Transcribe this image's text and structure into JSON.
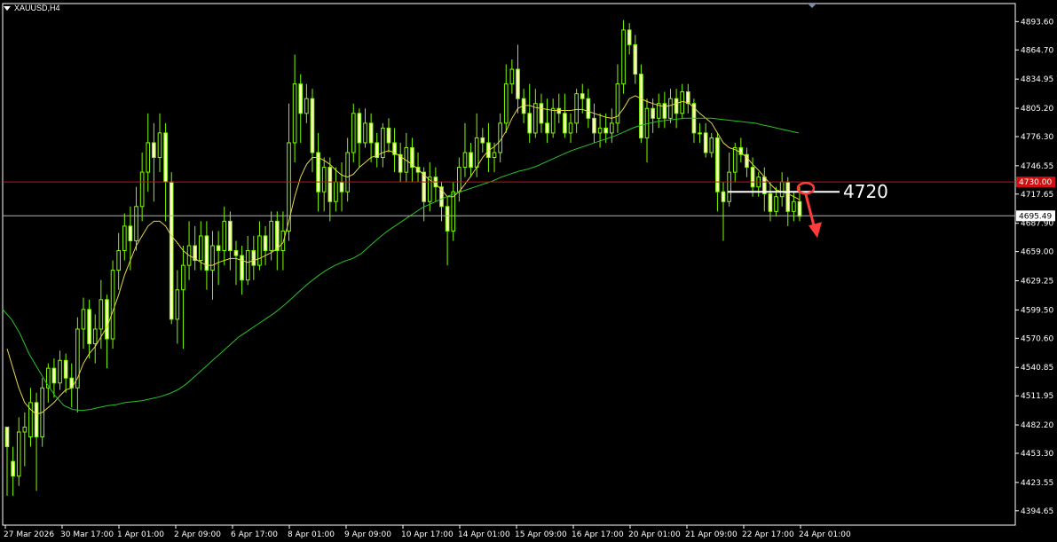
{
  "symbol_title": "XAUUSD,H4",
  "colors": {
    "background": "#000000",
    "frame": "#ffffff",
    "bull_candle": "#7cfc00",
    "bear_candle": "#ffffc0",
    "ma_fast": "#e8d44a",
    "ma_slow": "#27c427",
    "resistance_line": "#d01010",
    "current_price_line": "#b4b4b4",
    "annotation": "#ff3b3b",
    "annotation_text": "#ffffff"
  },
  "chart_data": {
    "type": "candlestick",
    "ylim": [
      4380,
      4912
    ],
    "y_ticks": [
      "4893.60",
      "4864.70",
      "4834.95",
      "4805.20",
      "4776.30",
      "4746.55",
      "4717.65",
      "4687.90",
      "4659.00",
      "4629.25",
      "4599.50",
      "4570.60",
      "4540.85",
      "4511.95",
      "4482.20",
      "4453.30",
      "4423.55",
      "4394.65"
    ],
    "x_ticks": [
      "27 Mar 2026",
      "30 Mar 17:00",
      "1 Apr 01:00",
      "2 Apr 09:00",
      "6 Apr 17:00",
      "8 Apr 01:00",
      "9 Apr 09:00",
      "10 Apr 17:00",
      "14 Apr 01:00",
      "15 Apr 09:00",
      "16 Apr 17:00",
      "20 Apr 01:00",
      "21 Apr 09:00",
      "22 Apr 17:00",
      "24 Apr 01:00"
    ],
    "resistance_price": 4730.0,
    "resistance_label": "4730.00",
    "current_price": 4695.49,
    "current_price_label": "4695.49",
    "annotation_level": 4720,
    "annotation_label": "4720",
    "candles": [
      [
        4480,
        4460,
        4410,
        4470
      ],
      [
        4445,
        4430,
        4410,
        4460
      ],
      [
        4430,
        4475,
        4420,
        4490
      ],
      [
        4475,
        4480,
        4440,
        4495
      ],
      [
        4470,
        4505,
        4460,
        4520
      ],
      [
        4505,
        4470,
        4415,
        4515
      ],
      [
        4470,
        4520,
        4460,
        4530
      ],
      [
        4520,
        4540,
        4505,
        4545
      ],
      [
        4540,
        4525,
        4510,
        4550
      ],
      [
        4525,
        4548,
        4518,
        4558
      ],
      [
        4548,
        4530,
        4515,
        4555
      ],
      [
        4530,
        4520,
        4500,
        4545
      ],
      [
        4520,
        4580,
        4495,
        4592
      ],
      [
        4580,
        4600,
        4560,
        4612
      ],
      [
        4600,
        4565,
        4550,
        4610
      ],
      [
        4565,
        4580,
        4545,
        4595
      ],
      [
        4580,
        4610,
        4560,
        4630
      ],
      [
        4610,
        4570,
        4540,
        4615
      ],
      [
        4570,
        4640,
        4560,
        4650
      ],
      [
        4640,
        4660,
        4620,
        4678
      ],
      [
        4660,
        4685,
        4650,
        4698
      ],
      [
        4685,
        4670,
        4640,
        4705
      ],
      [
        4670,
        4705,
        4660,
        4725
      ],
      [
        4705,
        4740,
        4690,
        4760
      ],
      [
        4740,
        4770,
        4720,
        4800
      ],
      [
        4770,
        4755,
        4710,
        4790
      ],
      [
        4755,
        4780,
        4740,
        4800
      ],
      [
        4780,
        4730,
        4690,
        4790
      ],
      [
        4730,
        4590,
        4585,
        4740
      ],
      [
        4590,
        4620,
        4565,
        4640
      ],
      [
        4620,
        4645,
        4560,
        4665
      ],
      [
        4645,
        4665,
        4630,
        4690
      ],
      [
        4665,
        4650,
        4640,
        4685
      ],
      [
        4650,
        4675,
        4640,
        4690
      ],
      [
        4675,
        4640,
        4620,
        4690
      ],
      [
        4640,
        4665,
        4610,
        4680
      ],
      [
        4665,
        4660,
        4625,
        4680
      ],
      [
        4660,
        4690,
        4645,
        4705
      ],
      [
        4690,
        4660,
        4640,
        4700
      ],
      [
        4660,
        4655,
        4625,
        4670
      ],
      [
        4655,
        4630,
        4615,
        4665
      ],
      [
        4630,
        4660,
        4625,
        4675
      ],
      [
        4660,
        4645,
        4630,
        4675
      ],
      [
        4645,
        4675,
        4640,
        4690
      ],
      [
        4675,
        4660,
        4645,
        4685
      ],
      [
        4660,
        4690,
        4650,
        4700
      ],
      [
        4690,
        4660,
        4640,
        4700
      ],
      [
        4660,
        4680,
        4640,
        4700
      ],
      [
        4680,
        4770,
        4670,
        4810
      ],
      [
        4770,
        4830,
        4750,
        4860
      ],
      [
        4830,
        4800,
        4770,
        4840
      ],
      [
        4800,
        4815,
        4790,
        4830
      ],
      [
        4815,
        4760,
        4740,
        4825
      ],
      [
        4760,
        4720,
        4700,
        4780
      ],
      [
        4720,
        4745,
        4700,
        4755
      ],
      [
        4745,
        4710,
        4690,
        4755
      ],
      [
        4710,
        4730,
        4700,
        4745
      ],
      [
        4730,
        4720,
        4700,
        4750
      ],
      [
        4720,
        4760,
        4710,
        4775
      ],
      [
        4760,
        4800,
        4750,
        4810
      ],
      [
        4800,
        4770,
        4745,
        4805
      ],
      [
        4770,
        4790,
        4765,
        4805
      ],
      [
        4790,
        4770,
        4750,
        4800
      ],
      [
        4770,
        4755,
        4745,
        4780
      ],
      [
        4755,
        4785,
        4745,
        4790
      ],
      [
        4785,
        4770,
        4760,
        4795
      ],
      [
        4770,
        4758,
        4740,
        4785
      ],
      [
        4758,
        4740,
        4730,
        4770
      ],
      [
        4740,
        4765,
        4730,
        4780
      ],
      [
        4765,
        4745,
        4730,
        4775
      ],
      [
        4745,
        4740,
        4730,
        4760
      ],
      [
        4740,
        4710,
        4690,
        4745
      ],
      [
        4710,
        4735,
        4700,
        4750
      ],
      [
        4735,
        4725,
        4710,
        4745
      ],
      [
        4725,
        4705,
        4690,
        4730
      ],
      [
        4705,
        4680,
        4645,
        4715
      ],
      [
        4680,
        4720,
        4670,
        4730
      ],
      [
        4720,
        4745,
        4710,
        4755
      ],
      [
        4745,
        4760,
        4735,
        4790
      ],
      [
        4760,
        4745,
        4735,
        4770
      ],
      [
        4745,
        4775,
        4735,
        4800
      ],
      [
        4775,
        4770,
        4760,
        4785
      ],
      [
        4770,
        4755,
        4740,
        4790
      ],
      [
        4755,
        4760,
        4740,
        4770
      ],
      [
        4760,
        4790,
        4750,
        4800
      ],
      [
        4790,
        4830,
        4780,
        4850
      ],
      [
        4830,
        4845,
        4820,
        4855
      ],
      [
        4845,
        4815,
        4800,
        4870
      ],
      [
        4815,
        4800,
        4790,
        4825
      ],
      [
        4800,
        4780,
        4770,
        4830
      ],
      [
        4780,
        4810,
        4775,
        4825
      ],
      [
        4810,
        4790,
        4780,
        4820
      ],
      [
        4790,
        4780,
        4770,
        4815
      ],
      [
        4780,
        4805,
        4775,
        4815
      ],
      [
        4805,
        4800,
        4790,
        4820
      ],
      [
        4800,
        4780,
        4775,
        4820
      ],
      [
        4780,
        4790,
        4770,
        4800
      ],
      [
        4790,
        4820,
        4780,
        4825
      ],
      [
        4820,
        4815,
        4800,
        4830
      ],
      [
        4815,
        4795,
        4785,
        4825
      ],
      [
        4795,
        4780,
        4770,
        4810
      ],
      [
        4780,
        4785,
        4765,
        4800
      ],
      [
        4785,
        4780,
        4770,
        4800
      ],
      [
        4780,
        4790,
        4770,
        4805
      ],
      [
        4790,
        4830,
        4780,
        4850
      ],
      [
        4830,
        4885,
        4820,
        4895
      ],
      [
        4885,
        4870,
        4860,
        4892
      ],
      [
        4870,
        4840,
        4830,
        4880
      ],
      [
        4840,
        4775,
        4770,
        4850
      ],
      [
        4775,
        4805,
        4750,
        4815
      ],
      [
        4805,
        4795,
        4780,
        4815
      ],
      [
        4795,
        4810,
        4785,
        4820
      ],
      [
        4810,
        4795,
        4785,
        4822
      ],
      [
        4795,
        4815,
        4790,
        4825
      ],
      [
        4815,
        4800,
        4785,
        4825
      ],
      [
        4800,
        4822,
        4795,
        4830
      ],
      [
        4822,
        4810,
        4800,
        4830
      ],
      [
        4810,
        4780,
        4770,
        4815
      ],
      [
        4780,
        4780,
        4770,
        4790
      ],
      [
        4780,
        4760,
        4755,
        4790
      ],
      [
        4760,
        4775,
        4755,
        4780
      ],
      [
        4775,
        4720,
        4700,
        4780
      ],
      [
        4720,
        4710,
        4670,
        4730
      ],
      [
        4710,
        4740,
        4705,
        4760
      ],
      [
        4740,
        4765,
        4730,
        4770
      ],
      [
        4765,
        4758,
        4750,
        4775
      ],
      [
        4758,
        4745,
        4735,
        4765
      ],
      [
        4745,
        4725,
        4715,
        4755
      ],
      [
        4725,
        4735,
        4715,
        4740
      ],
      [
        4735,
        4718,
        4700,
        4745
      ],
      [
        4718,
        4700,
        4690,
        4730
      ],
      [
        4700,
        4715,
        4695,
        4725
      ],
      [
        4715,
        4730,
        4705,
        4740
      ],
      [
        4730,
        4700,
        4685,
        4735
      ],
      [
        4700,
        4710,
        4690,
        4720
      ],
      [
        4710,
        4695,
        4690,
        4725
      ]
    ],
    "ma_fast": [
      4560,
      4540,
      4520,
      4505,
      4498,
      4493,
      4495,
      4500,
      4505,
      4512,
      4518,
      4520,
      4530,
      4545,
      4555,
      4562,
      4572,
      4582,
      4598,
      4615,
      4635,
      4650,
      4665,
      4675,
      4685,
      4690,
      4690,
      4685,
      4675,
      4668,
      4660,
      4655,
      4652,
      4648,
      4645,
      4645,
      4648,
      4650,
      4652,
      4652,
      4650,
      4648,
      4650,
      4652,
      4655,
      4658,
      4662,
      4668,
      4690,
      4715,
      4735,
      4748,
      4755,
      4755,
      4752,
      4748,
      4742,
      4737,
      4735,
      4738,
      4745,
      4750,
      4755,
      4757,
      4760,
      4762,
      4760,
      4756,
      4752,
      4748,
      4743,
      4737,
      4732,
      4728,
      4722,
      4715,
      4715,
      4720,
      4728,
      4736,
      4745,
      4755,
      4762,
      4766,
      4772,
      4782,
      4795,
      4805,
      4808,
      4808,
      4806,
      4805,
      4804,
      4803,
      4803,
      4803,
      4803,
      4804,
      4804,
      4802,
      4800,
      4798,
      4796,
      4795,
      4797,
      4805,
      4815,
      4818,
      4815,
      4812,
      4810,
      4808,
      4807,
      4808,
      4810,
      4812,
      4811,
      4806,
      4800,
      4795,
      4790,
      4780,
      4770,
      4765,
      4763,
      4760,
      4755,
      4748,
      4742,
      4735,
      4728,
      4722,
      4720,
      4718,
      4715,
      4712
    ],
    "ma_slow": [
      4600,
      4590,
      4575,
      4555,
      4540,
      4525,
      4512,
      4502,
      4498,
      4497,
      4498,
      4500,
      4502,
      4503,
      4505,
      4506,
      4507,
      4509,
      4511,
      4514,
      4518,
      4524,
      4532,
      4540,
      4548,
      4556,
      4564,
      4572,
      4578,
      4584,
      4590,
      4596,
      4603,
      4611,
      4619,
      4627,
      4634,
      4640,
      4645,
      4649,
      4652,
      4657,
      4665,
      4673,
      4680,
      4686,
      4692,
      4698,
      4704,
      4708,
      4712,
      4716,
      4719,
      4722,
      4725,
      4728,
      4731,
      4735,
      4738,
      4741,
      4743,
      4746,
      4750,
      4754,
      4758,
      4762,
      4765,
      4768,
      4771,
      4774,
      4777,
      4781,
      4785,
      4788,
      4790,
      4792,
      4793,
      4794,
      4795,
      4795,
      4795,
      4795,
      4794,
      4793,
      4792,
      4791,
      4790,
      4788,
      4786,
      4784,
      4782,
      4780
    ]
  }
}
